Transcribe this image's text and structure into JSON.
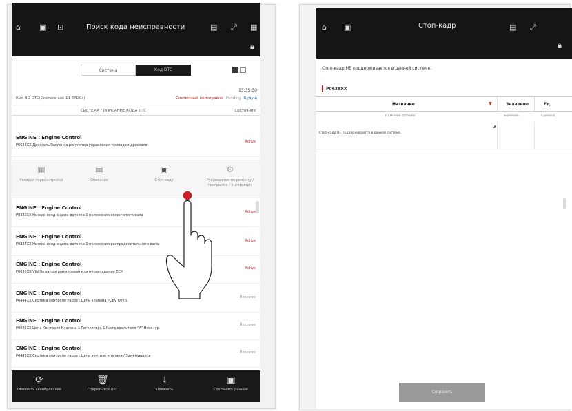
{
  "left": {
    "title": "Поиск кода неисправности",
    "tabs": [
      "Система",
      "Код DTC"
    ],
    "time": "13:35:30",
    "sys_info": "Кол-ВО DTC(Системные: 11 EPDCs)",
    "legend": [
      "Системный неисправно",
      "Pending",
      "Будущ"
    ],
    "column_header": "СИСТЕМА / ОПИСАНИЕ КОДА DTC",
    "column_status": "Состояние",
    "dtc_items": [
      {
        "title": "ENGINE : Engine Control",
        "desc": "P0638XX Дроссель/Заслонка регулятор управления приводом дросселя",
        "status": "Active"
      },
      {
        "title": "ENGINE : Engine Control",
        "desc": "P0320XX Низкий вход в цепи датчика 1 положения коленчатого вала",
        "status": "Active"
      },
      {
        "title": "ENGINE : Engine Control",
        "desc": "P0337XX Низкий вход в цепи датчика 1 положения распределительного вала",
        "status": "Active"
      },
      {
        "title": "ENGINE : Engine Control",
        "desc": "P0630XX VIN Не запрограммирован или несовпадение ECM",
        "status": "Active"
      },
      {
        "title": "ENGINE : Engine Control",
        "desc": "P0444XX Система контроля паров : Цепь клапана PCBV Откр.",
        "status": "Unknown"
      },
      {
        "title": "ENGINE : Engine Control",
        "desc": "P0085XX Цепь Контроля Клапана 1 Регулятора 1 Распределителя \"А\" Низк. ур.",
        "status": "Unknown"
      },
      {
        "title": "ENGINE : Engine Control",
        "desc": "P0445XX Система контроля паров : Цепь вентиль клапана / Замкнувшись",
        "status": "Unknown"
      }
    ],
    "actions": [
      {
        "icon": "calendar-icon",
        "label": "Условия перенастройки"
      },
      {
        "icon": "document-icon",
        "label": "Описание"
      },
      {
        "icon": "freeze-frame-icon",
        "label": "Стоп-кадр"
      },
      {
        "icon": "gear-icon",
        "label": "Руководство по ремонту / программе / инструкция"
      }
    ],
    "bottom": [
      {
        "icon": "refresh-icon",
        "label": "Обновить сканирование"
      },
      {
        "icon": "trash-icon",
        "label": "Стереть все DTC"
      },
      {
        "icon": "download-icon",
        "label": "Показать"
      },
      {
        "icon": "save-icon",
        "label": "Сохранить данные"
      }
    ]
  },
  "right": {
    "title": "Стоп-кадр",
    "info": "Стоп-кадр НЕ поддерживается в данной системе.",
    "section": "P0638XX",
    "headers": [
      "Название",
      "Значение",
      "Ед."
    ],
    "subheaders": [
      "Название датчика",
      "Значение",
      "Единица"
    ],
    "row_msg": "Стоп-кадр НЕ поддерживается в данной системе.",
    "save": "Сохранить"
  },
  "colors": {
    "accent": "#c9201f",
    "bar": "#151515"
  }
}
